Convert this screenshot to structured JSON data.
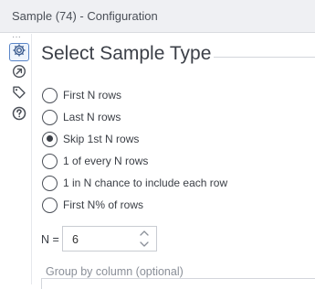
{
  "window": {
    "title": "Sample (74) - Configuration"
  },
  "rail": {
    "items": [
      {
        "icon": "gear-icon",
        "active": true
      },
      {
        "icon": "compass-icon",
        "active": false
      },
      {
        "icon": "tag-icon",
        "active": false
      },
      {
        "icon": "help-icon",
        "active": false
      }
    ]
  },
  "main": {
    "heading": "Select Sample Type",
    "options": [
      {
        "label": "First N rows",
        "checked": false
      },
      {
        "label": "Last N rows",
        "checked": false
      },
      {
        "label": "Skip 1st N rows",
        "checked": true
      },
      {
        "label": "1 of every N rows",
        "checked": false
      },
      {
        "label": "1 in N chance to include each row",
        "checked": false
      },
      {
        "label": "First N% of rows",
        "checked": false
      }
    ],
    "n_label": "N =",
    "n_value": "6",
    "group_by_label": "Group by column (optional)"
  },
  "colors": {
    "accent": "#5a86c8",
    "rail_icon": "#4b5058"
  }
}
